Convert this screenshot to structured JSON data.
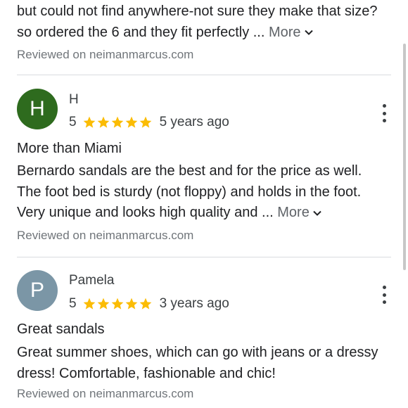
{
  "prev_review": {
    "text": "but could not find anywhere-not sure they make that size? so ordered the 6 and they fit perfectly ...",
    "more": "More",
    "source": "Reviewed on neimanmarcus.com"
  },
  "reviews": [
    {
      "initial": "H",
      "avatar_color": "#2e6b1e",
      "name": "H",
      "rating": "5",
      "stars": 5,
      "time": "5 years ago",
      "title": "More than Miami",
      "text": "Bernardo sandals are the best and for the price as well. The foot bed is sturdy (not floppy) and holds in the foot. Very unique and looks high quality and ...",
      "more": "More",
      "source": "Reviewed on neimanmarcus.com"
    },
    {
      "initial": "P",
      "avatar_color": "#7b96a6",
      "name": "Pamela",
      "rating": "5",
      "stars": 5,
      "time": "3 years ago",
      "title": "Great sandals",
      "text": "Great summer shoes, which can go with jeans or a dressy dress! Comfortable, fashionable and chic!",
      "source": "Reviewed on neimanmarcus.com"
    }
  ],
  "colors": {
    "star": "#fbbc04",
    "divider": "#dadce0",
    "muted": "#70757a"
  }
}
